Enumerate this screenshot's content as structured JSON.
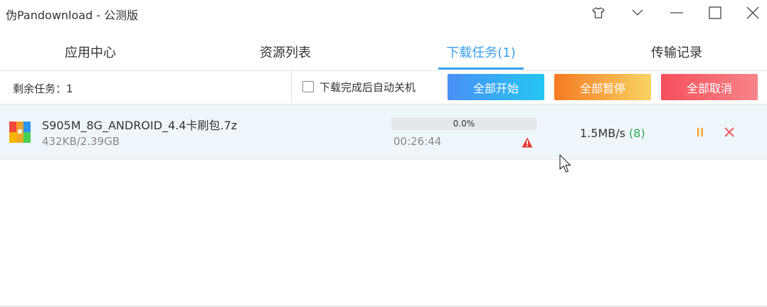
{
  "window": {
    "title": "伪Pandownload - 公测版"
  },
  "titlebar_icons": {
    "skin": "tshirt-icon",
    "menu": "chevron-down-icon",
    "minimize": "minimize-icon",
    "maximize": "maximize-icon",
    "close": "close-icon"
  },
  "tabs": [
    {
      "label": "应用中心",
      "active": false
    },
    {
      "label": "资源列表",
      "active": false
    },
    {
      "label": "下载任务(1)",
      "active": true
    },
    {
      "label": "传输记录",
      "active": false
    }
  ],
  "toolbar": {
    "remaining_label": "剩余任务：1",
    "auto_shutdown_label": "下载完成后自动关机",
    "auto_shutdown_checked": false,
    "start_all_label": "全部开始",
    "pause_all_label": "全部暂停",
    "cancel_all_label": "全部取消"
  },
  "tasks": [
    {
      "icon": "archive-file-icon",
      "name": "S905M_8G_ANDROID_4.4卡刷包.7z",
      "size": "432KB/2.39GB",
      "progress_text": "0.0%",
      "progress_percent": 0.0,
      "time_left": "00:26:44",
      "warning_icon": "warning-icon",
      "speed": "1.5MB/s",
      "connections": "(8)"
    }
  ],
  "colors": {
    "accent": "#3a9ff0",
    "row_bg": "#eef6fc",
    "start_gradient": [
      "#4a90f5",
      "#24c6f2"
    ],
    "pause_gradient": [
      "#f57a22",
      "#f8d362"
    ],
    "cancel_gradient": [
      "#f5505b",
      "#f7848a"
    ],
    "pause_icon": "#f5a623",
    "close_icon": "#f25a5a",
    "warning": "#e53935",
    "connections": "#2fa84f"
  }
}
